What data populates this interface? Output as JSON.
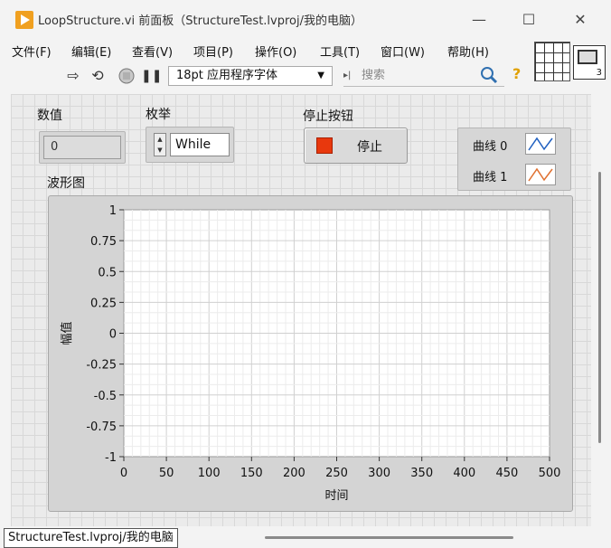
{
  "window": {
    "title": "LoopStructure.vi 前面板（StructureTest.lvproj/我的电脑）",
    "minimize": "—",
    "maximize": "☐",
    "close": "✕"
  },
  "menu": [
    "文件(F)",
    "编辑(E)",
    "查看(V)",
    "项目(P)",
    "操作(O)",
    "工具(T)",
    "窗口(W)",
    "帮助(H)"
  ],
  "toolbar": {
    "font": "18pt 应用程序字体",
    "search_placeholder": "搜索",
    "icons": [
      "run-arrow-icon",
      "run-continuously-icon",
      "abort-icon",
      "pause-icon",
      "search-icon",
      "help-icon"
    ]
  },
  "vi_icon": {
    "connector_count": "3"
  },
  "controls": {
    "numeric": {
      "label": "数值",
      "value": "0"
    },
    "enum": {
      "label": "枚举",
      "value": "While"
    },
    "stop": {
      "label": "停止按钮",
      "button_text": "停止",
      "led_color": "#e8380d"
    },
    "legend": {
      "entries": [
        {
          "name": "曲线 0",
          "icon": "plot-line-icon",
          "color": "#2060c0"
        },
        {
          "name": "曲线 1",
          "icon": "plot-line-icon",
          "color": "#e07030"
        }
      ]
    }
  },
  "graph_label": "波形图",
  "chart_data": {
    "type": "line",
    "title": "",
    "xlabel": "时间",
    "ylabel": "幅值",
    "xlim": [
      0,
      500
    ],
    "ylim": [
      -1,
      1
    ],
    "x_ticks": [
      "0",
      "50",
      "100",
      "150",
      "200",
      "250",
      "300",
      "350",
      "400",
      "450",
      "500"
    ],
    "y_ticks": [
      "1",
      "0.75",
      "0.5",
      "0.25",
      "0",
      "-0.25",
      "-0.5",
      "-0.75",
      "-1"
    ],
    "grid": true,
    "series": []
  },
  "status": {
    "path": "StructureTest.lvproj/我的电脑"
  }
}
